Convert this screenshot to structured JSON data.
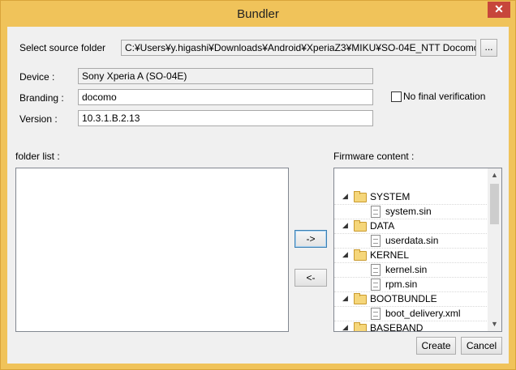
{
  "window": {
    "title": "Bundler",
    "close_label": "✕"
  },
  "source": {
    "label": "Select source folder",
    "path": "C:¥Users¥y.higashi¥Downloads¥Android¥XperiaZ3¥MIKU¥SO-04E_NTT Docomo",
    "browse_label": "..."
  },
  "device": {
    "label": "Device :",
    "value": "Sony Xperia A (SO-04E)"
  },
  "branding": {
    "label": "Branding :",
    "value": "docomo"
  },
  "version": {
    "label": "Version :",
    "value": "10.3.1.B.2.13"
  },
  "no_final_verification": {
    "label": "No final verification",
    "checked": false
  },
  "folder_list": {
    "label": "folder list :",
    "items": []
  },
  "firmware": {
    "label": "Firmware content :",
    "tree": [
      {
        "type": "folder",
        "name": "SYSTEM"
      },
      {
        "type": "file",
        "name": "system.sin"
      },
      {
        "type": "folder",
        "name": "DATA"
      },
      {
        "type": "file",
        "name": "userdata.sin"
      },
      {
        "type": "folder",
        "name": "KERNEL"
      },
      {
        "type": "file",
        "name": "kernel.sin"
      },
      {
        "type": "file",
        "name": "rpm.sin"
      },
      {
        "type": "folder",
        "name": "BOOTBUNDLE"
      },
      {
        "type": "file",
        "name": "boot_delivery.xml"
      },
      {
        "type": "folder",
        "name": "BASEBAND"
      }
    ]
  },
  "buttons": {
    "add": "->",
    "remove": "<-",
    "create": "Create",
    "cancel": "Cancel"
  },
  "colors": {
    "title_bar": "#f0c35a",
    "close_button": "#c7463b",
    "client_bg": "#f0f0f0"
  }
}
